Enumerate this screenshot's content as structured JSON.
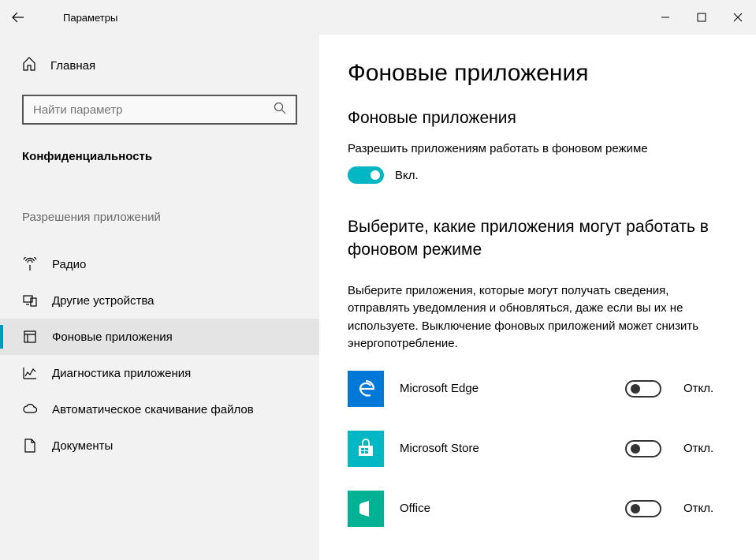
{
  "titlebar": {
    "title": "Параметры"
  },
  "sidebar": {
    "home_label": "Главная",
    "search_placeholder": "Найти параметр",
    "category_label": "Конфиденциальность",
    "section_title": "Разрешения приложений",
    "items": [
      {
        "label": "Радио"
      },
      {
        "label": "Другие устройства"
      },
      {
        "label": "Фоновые приложения"
      },
      {
        "label": "Диагностика приложения"
      },
      {
        "label": "Автоматическое скачивание файлов"
      },
      {
        "label": "Документы"
      }
    ]
  },
  "main": {
    "page_title": "Фоновые приложения",
    "section1_heading": "Фоновые приложения",
    "allow_text": "Разрешить приложениям работать в фоновом режиме",
    "master_toggle_label": "Вкл.",
    "section2_heading": "Выберите, какие приложения могут работать в фоновом режиме",
    "section2_body": "Выберите приложения, которые могут получать сведения, отправлять уведомления и обновляться, даже если вы их не используете. Выключение фоновых приложений может снизить энергопотребление.",
    "apps": [
      {
        "name": "Microsoft Edge",
        "toggle_label": "Откл."
      },
      {
        "name": "Microsoft Store",
        "toggle_label": "Откл."
      },
      {
        "name": "Office",
        "toggle_label": "Откл."
      }
    ]
  }
}
